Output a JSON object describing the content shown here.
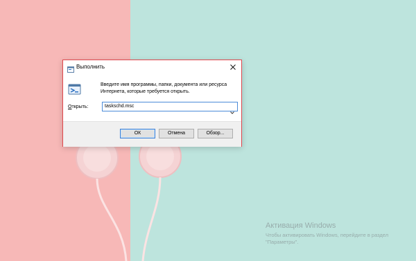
{
  "dialog": {
    "title": "Выполнить",
    "description": "Введите имя программы, папки, документа или ресурса Интернета, которые требуется открыть.",
    "open_label_prefix": "О",
    "open_label_rest": "ткрыть:",
    "open_value": "taskschd.msc",
    "buttons": {
      "ok": "ОК",
      "cancel": "Отмена",
      "browse": "Обзор..."
    },
    "icons": {
      "title": "run-icon",
      "close": "close-icon",
      "caret": "chevron-down-icon",
      "body": "run-dialog-icon"
    }
  },
  "watermark": {
    "title": "Активация Windows",
    "subtitle": "Чтобы активировать Windows, перейдите в раздел \"Параметры\"."
  },
  "colors": {
    "wallpaper_left": "#f7b8b7",
    "wallpaper_right": "#bde4dd",
    "dialog_border": "#e0484d",
    "focus_blue": "#3c7fd6"
  }
}
